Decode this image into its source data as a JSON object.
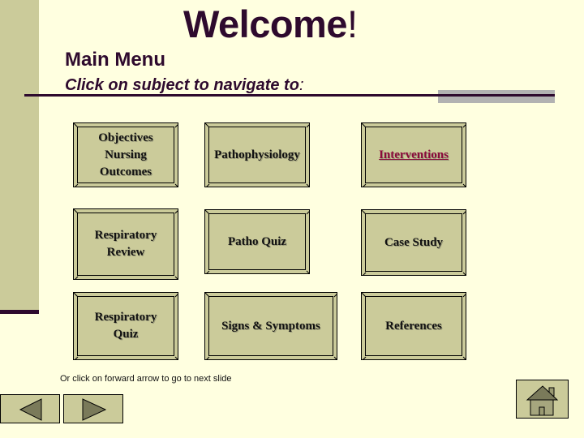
{
  "slide": {
    "title": "Welcome",
    "title_suffix": "!",
    "subtitle": "Main Menu",
    "instruction": "Click on subject to navigate to",
    "instruction_suffix": ":"
  },
  "menu": {
    "buttons": [
      {
        "label": "Objectives\nNursing\nOutcomes",
        "style": "normal"
      },
      {
        "label": "Pathophysiology",
        "style": "normal"
      },
      {
        "label": "Interventions",
        "style": "link"
      },
      {
        "label": "Respiratory\nReview",
        "style": "normal"
      },
      {
        "label": "Patho Quiz",
        "style": "normal"
      },
      {
        "label": "Case Study",
        "style": "normal"
      },
      {
        "label": "Respiratory\nQuiz",
        "style": "normal"
      },
      {
        "label": "Signs & Symptoms",
        "style": "normal"
      },
      {
        "label": "References",
        "style": "normal"
      }
    ]
  },
  "navigation": {
    "hint": "Or click on forward arrow to go to next slide",
    "back_icon": "triangle-left",
    "forward_icon": "triangle-right",
    "home_icon": "house"
  },
  "colors": {
    "background": "#FFFFE0",
    "panel": "#CBCB9A",
    "accent_dark": "#2E0A2E",
    "link": "#8B0A3A",
    "rule_gray": "#B2B2B2"
  }
}
